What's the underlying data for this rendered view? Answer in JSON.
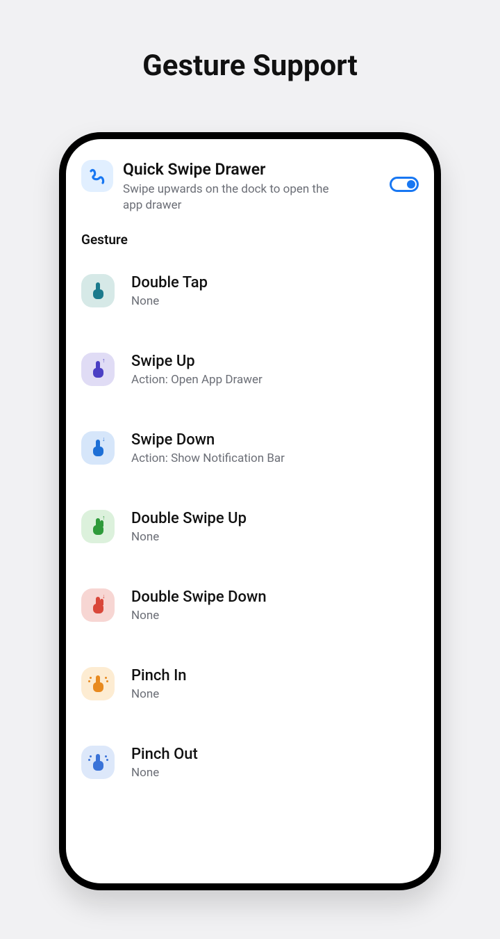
{
  "page": {
    "title": "Gesture Support"
  },
  "quick": {
    "title": "Quick Swipe Drawer",
    "subtitle": "Swipe upwards on the dock to open the app drawer",
    "toggle_on": true
  },
  "section": {
    "label": "Gesture"
  },
  "gestures": [
    {
      "id": "double-tap",
      "title": "Double Tap",
      "subtitle": "None",
      "bg": "bg-teal",
      "color": "c-teal",
      "two_fingers": false,
      "arrow": "none",
      "pinch": false
    },
    {
      "id": "swipe-up",
      "title": "Swipe Up",
      "subtitle": "Action: Open App Drawer",
      "bg": "bg-lav",
      "color": "c-lav",
      "two_fingers": false,
      "arrow": "up",
      "pinch": false
    },
    {
      "id": "swipe-down",
      "title": "Swipe Down",
      "subtitle": "Action: Show Notification Bar",
      "bg": "bg-blue",
      "color": "c-blue",
      "two_fingers": false,
      "arrow": "down",
      "pinch": false
    },
    {
      "id": "double-swipe-up",
      "title": "Double Swipe Up",
      "subtitle": "None",
      "bg": "bg-green",
      "color": "c-green",
      "two_fingers": true,
      "arrow": "up",
      "pinch": false
    },
    {
      "id": "double-swipe-down",
      "title": "Double Swipe Down",
      "subtitle": "None",
      "bg": "bg-red",
      "color": "c-red",
      "two_fingers": true,
      "arrow": "down",
      "pinch": false
    },
    {
      "id": "pinch-in",
      "title": "Pinch In",
      "subtitle": "None",
      "bg": "bg-orange",
      "color": "c-orange",
      "two_fingers": false,
      "arrow": "none",
      "pinch": true
    },
    {
      "id": "pinch-out",
      "title": "Pinch Out",
      "subtitle": "None",
      "bg": "bg-lblue",
      "color": "c-lblue",
      "two_fingers": false,
      "arrow": "none",
      "pinch": true
    }
  ]
}
